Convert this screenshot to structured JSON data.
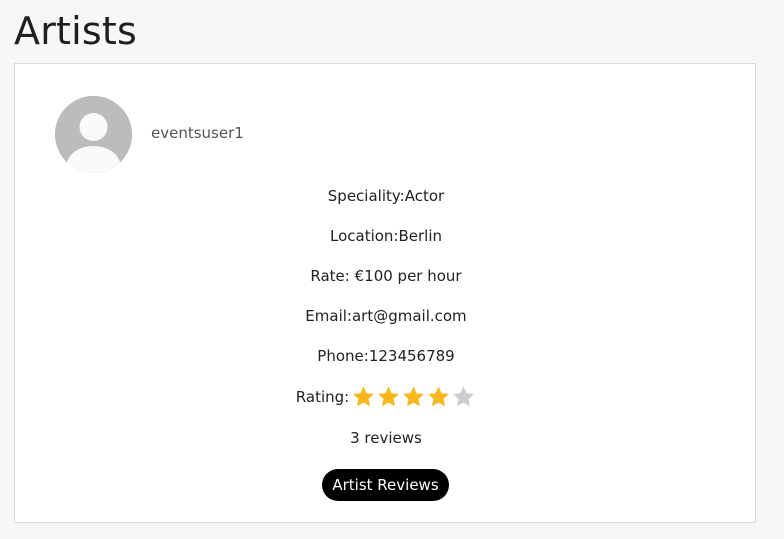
{
  "page": {
    "title": "Artists"
  },
  "artist": {
    "username": "eventsuser1",
    "avatar_icon": "user-placeholder-icon",
    "speciality_label": "Speciality:",
    "speciality": "Actor",
    "location_label": "Location:",
    "location": "Berlin",
    "rate_label": "Rate: ",
    "rate": "€100 per hour",
    "email_label": "Email:",
    "email": "art@gmail.com",
    "phone_label": "Phone:",
    "phone": "123456789",
    "rating_label": "Rating:",
    "rating": 4,
    "rating_max": 5,
    "reviews_text": "3 reviews",
    "reviews_button_label": "Artist Reviews"
  },
  "colors": {
    "star_filled": "#f8b81b",
    "star_empty": "#cccccc",
    "avatar_bg": "#bcbcbc",
    "button_bg": "#000000"
  }
}
